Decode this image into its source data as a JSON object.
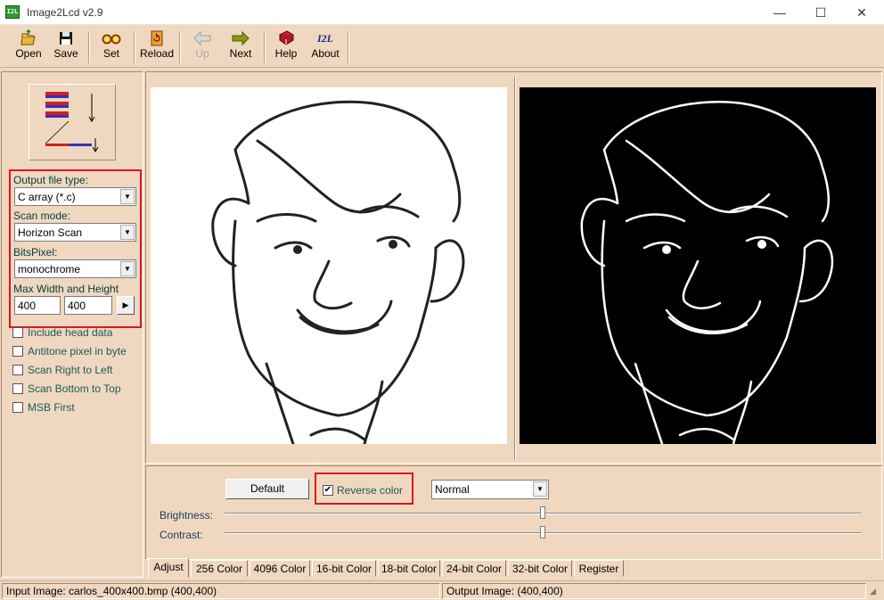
{
  "window": {
    "title": "Image2Lcd v2.9",
    "icon_text": "I2L"
  },
  "toolbar": {
    "open": "Open",
    "save": "Save",
    "set": "Set",
    "reload": "Reload",
    "up": "Up",
    "next": "Next",
    "help": "Help",
    "about": "About",
    "about_icon_text": "I2L"
  },
  "settings": {
    "output_type_label": "Output file type:",
    "output_type_value": "C array (*.c)",
    "scan_mode_label": "Scan mode:",
    "scan_mode_value": "Horizon Scan",
    "bits_pixel_label": "BitsPixel:",
    "bits_pixel_value": "monochrome",
    "max_wh_label": "Max Width and Height",
    "max_width": "400",
    "max_height": "400"
  },
  "options": [
    {
      "label": "Include head data",
      "checked": false
    },
    {
      "label": "Antitone pixel in byte",
      "checked": false
    },
    {
      "label": "Scan Right to Left",
      "checked": false
    },
    {
      "label": "Scan Bottom to Top",
      "checked": false
    },
    {
      "label": "MSB First",
      "checked": false
    }
  ],
  "adjust": {
    "default_label": "Default",
    "reverse_label": "Reverse color",
    "reverse_checked": true,
    "mode_value": "Normal",
    "brightness_label": "Brightness:",
    "contrast_label": "Contrast:",
    "brightness_level": 0.5,
    "contrast_level": 0.5
  },
  "tabs": [
    "Adjust",
    "256 Color",
    "4096 Color",
    "16-bit Color",
    "18-bit Color",
    "24-bit Color",
    "32-bit Color",
    "Register"
  ],
  "status": {
    "input": "Input Image: carlos_400x400.bmp (400,400)",
    "output": "Output Image: (400,400)"
  },
  "colors": {
    "highlight": "#e0141e",
    "background": "#f0d8c0"
  }
}
